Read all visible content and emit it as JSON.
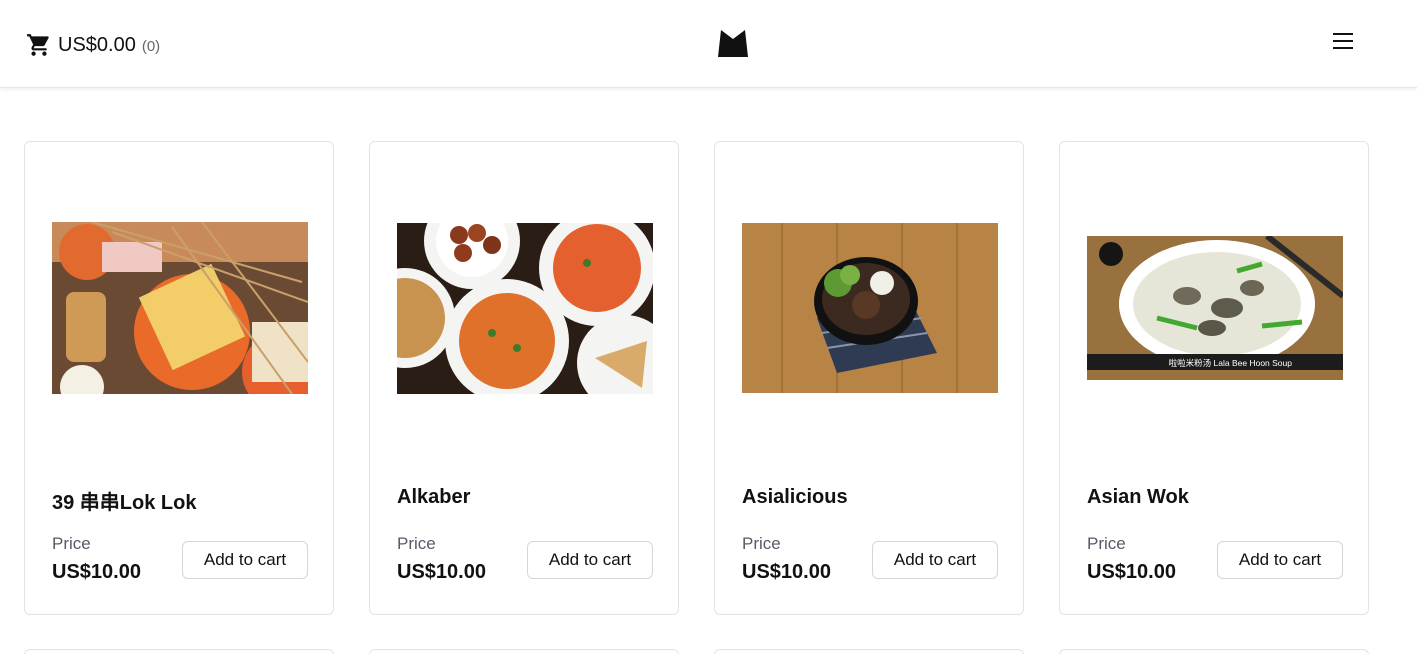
{
  "header": {
    "cart_icon": "shopping-cart-icon",
    "cart_total": "US$0.00",
    "cart_count": "(0)",
    "logo_icon": "crown-logo-icon",
    "menu_icon": "hamburger-menu-icon"
  },
  "products": [
    {
      "name": "39 串串Lok Lok",
      "price_label": "Price",
      "price": "US$10.00",
      "button_label": "Add to cart",
      "image": "lok-lok-skewers-photo"
    },
    {
      "name": "Alkaber",
      "price_label": "Price",
      "price": "US$10.00",
      "button_label": "Add to cart",
      "image": "curry-dishes-photo"
    },
    {
      "name": "Asialicious",
      "price_label": "Price",
      "price": "US$10.00",
      "button_label": "Add to cart",
      "image": "rice-bowl-photo"
    },
    {
      "name": "Asian Wok",
      "price_label": "Price",
      "price": "US$10.00",
      "button_label": "Add to cart",
      "image": "lala-soup-photo",
      "image_caption": "啦啦米粉汤 Lala Bee Hoon Soup"
    }
  ],
  "colors": {
    "text": "#111111",
    "muted": "#555c66",
    "border": "#e3e3e3"
  }
}
